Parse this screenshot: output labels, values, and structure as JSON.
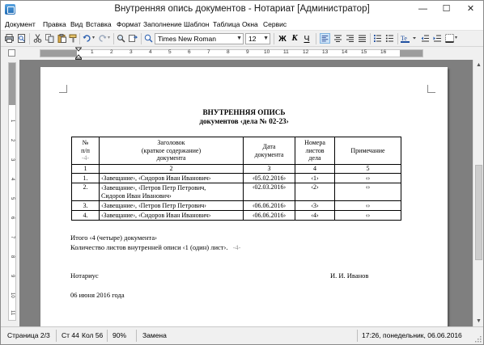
{
  "window": {
    "title": "Внутренняя опись документов - Нотариат [Администратор]",
    "minimize": "—",
    "maximize": "☐",
    "close": "✕"
  },
  "menu": [
    "Документ",
    "Правка",
    "Вид",
    "Вставка",
    "Формат",
    "Заполнение",
    "Шаблон",
    "Таблица",
    "Окна",
    "Сервис"
  ],
  "toolbar": {
    "font_name": "Times New Roman",
    "font_size": "12",
    "bold": "Ж",
    "italic": "К",
    "underline": "Ч",
    "colors": {
      "font_color": "#1f4fa0",
      "accent": "#3a78c8"
    }
  },
  "ruler": {
    "numbers": [
      "1",
      "2",
      "3",
      "4",
      "5",
      "6",
      "7",
      "8",
      "9",
      "10",
      "11",
      "12",
      "13",
      "14",
      "15",
      "16"
    ],
    "vnumbers": [
      "1",
      "2",
      "3",
      "4",
      "5",
      "6",
      "7",
      "8",
      "9",
      "10",
      "11"
    ]
  },
  "document": {
    "title_line1": "ВНУТРЕННЯЯ ОПИСЬ",
    "title_line2": "документов ‹дела № 02-23›",
    "table": {
      "headers": [
        {
          "lines": [
            "№",
            "п/п",
            "-4-"
          ]
        },
        {
          "lines": [
            "Заголовок",
            "(краткое содержание)",
            "документа"
          ]
        },
        {
          "lines": [
            "Дата",
            "документа"
          ]
        },
        {
          "lines": [
            "Номера",
            "листов",
            "дела"
          ]
        },
        {
          "lines": [
            "Примечание"
          ]
        }
      ],
      "numbering": [
        "1",
        "2",
        "3",
        "4",
        "5"
      ],
      "rows": [
        {
          "num": "1.",
          "title": [
            "‹Завещание›, ‹Сидоров Иван Иванович›"
          ],
          "date": "‹05.02.2016›",
          "sheets": "‹1›",
          "note": "‹›"
        },
        {
          "num": "2.",
          "title": [
            "‹Завещание›, ‹Петров Петр Петрович,",
            "Сидоров Иван Иванович›"
          ],
          "date": "‹02.03.2016›",
          "sheets": "‹2›",
          "note": "‹›"
        },
        {
          "num": "3.",
          "title": [
            "‹Завещание›, ‹Петров Петр Петрович›"
          ],
          "date": "‹06.06.2016›",
          "sheets": "‹3›",
          "note": "‹›"
        },
        {
          "num": "4.",
          "title": [
            "‹Завещание›, ‹Сидоров Иван Иванович›"
          ],
          "date": "‹06.06.2016›",
          "sheets": "‹4›",
          "note": "‹›"
        }
      ]
    },
    "total_line": "Итого ‹4 (четыре) документа›",
    "sheets_line": "Количество листов внутренней описи ‹1 (один) лист›.",
    "sheets_marker": "-4-",
    "notary_label": "Нотариус",
    "notary_name": "И. И. Иванов",
    "date_line": "06 июня 2016 года"
  },
  "status": {
    "page": "Страница 2/3",
    "line": "Ст 44",
    "col": "Кол 56",
    "zoom": "90%",
    "mode": "Замена",
    "datetime": "17:26, понедельник, 06.06.2016"
  }
}
